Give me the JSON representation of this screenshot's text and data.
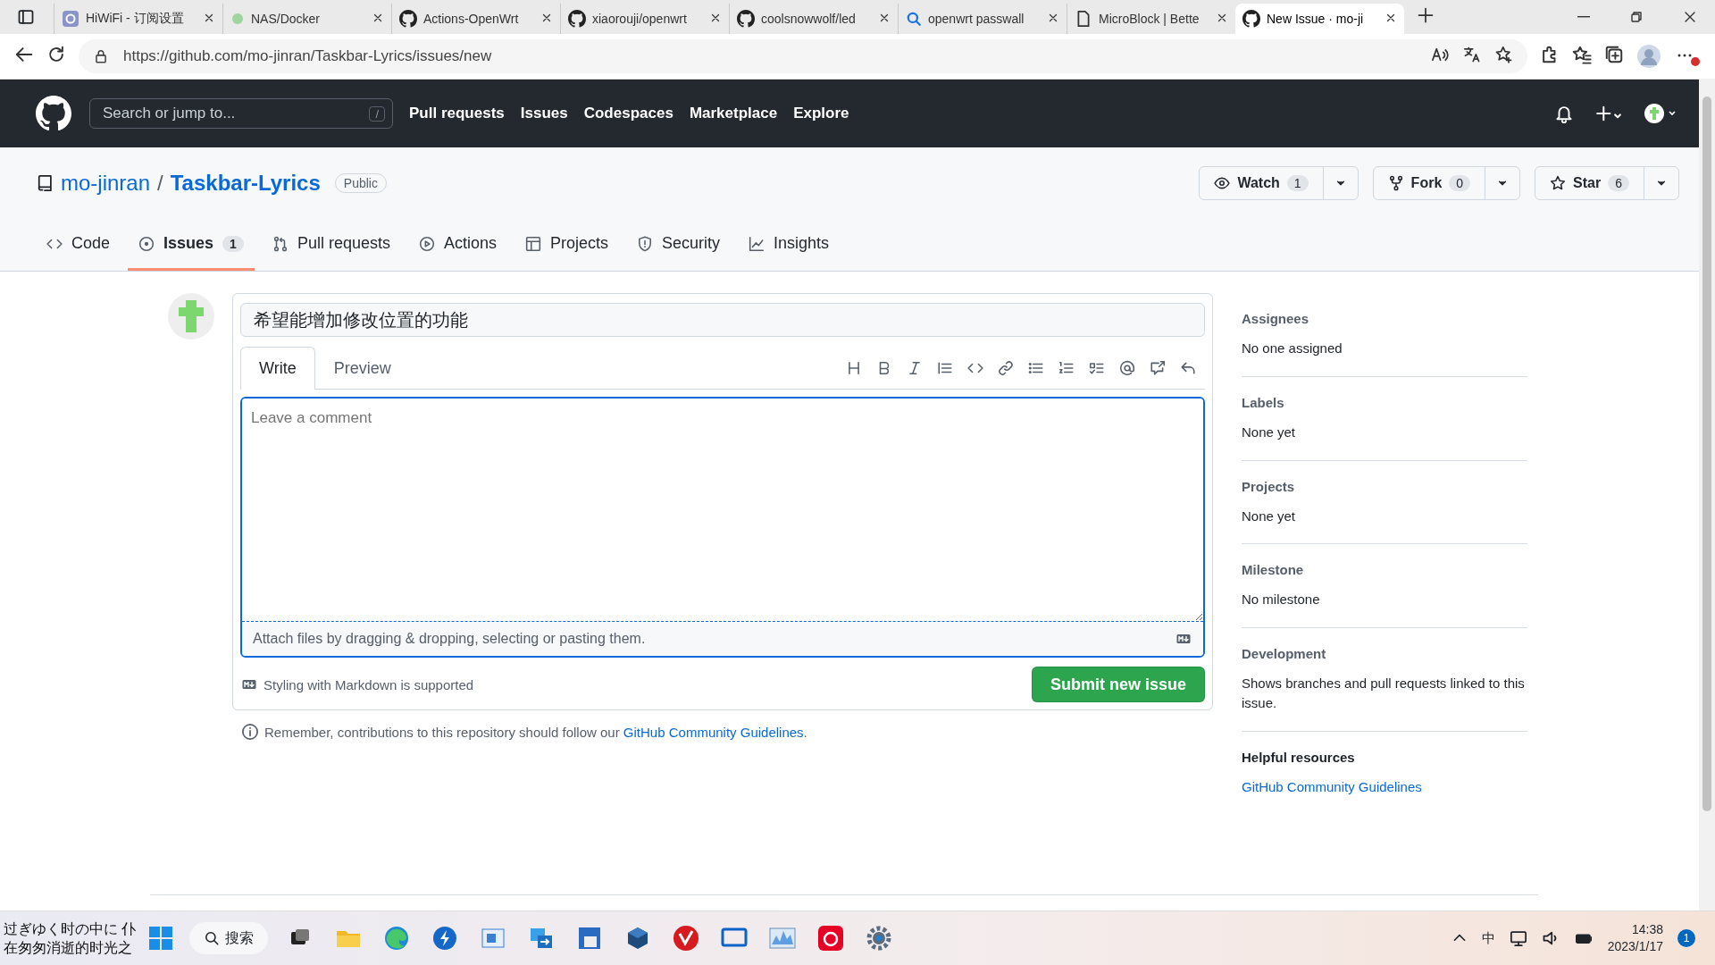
{
  "browser": {
    "tabs": [
      {
        "title": "HiWiFi - 订阅设置",
        "kind": "square",
        "selected": false
      },
      {
        "title": "NAS/Docker",
        "kind": "dot",
        "selected": false
      },
      {
        "title": "Actions-OpenWrt",
        "kind": "github",
        "selected": false
      },
      {
        "title": "xiaorouji/openwrt",
        "kind": "github",
        "selected": false
      },
      {
        "title": "coolsnowwolf/led",
        "kind": "github",
        "selected": false
      },
      {
        "title": "openwrt passwall",
        "kind": "search",
        "selected": false
      },
      {
        "title": "MicroBlock | Bette",
        "kind": "page",
        "selected": false
      },
      {
        "title": "New Issue · mo-ji",
        "kind": "github",
        "selected": true
      }
    ],
    "url": "https://github.com/mo-jinran/Taskbar-Lyrics/issues/new"
  },
  "header": {
    "search_placeholder": "Search or jump to...",
    "shortcut": "/",
    "nav": [
      "Pull requests",
      "Issues",
      "Codespaces",
      "Marketplace",
      "Explore"
    ]
  },
  "repo": {
    "owner": "mo-jinran",
    "separator": "/",
    "name": "Taskbar-Lyrics",
    "visibility": "Public",
    "actions": [
      {
        "kind": "watch",
        "label": "Watch",
        "count": "1"
      },
      {
        "kind": "fork",
        "label": "Fork",
        "count": "0"
      },
      {
        "kind": "star",
        "label": "Star",
        "count": "6"
      }
    ],
    "tabs": [
      {
        "kind": "code",
        "label": "Code",
        "selected": false
      },
      {
        "kind": "issues",
        "label": "Issues",
        "count": "1",
        "selected": true
      },
      {
        "kind": "pulls",
        "label": "Pull requests",
        "selected": false
      },
      {
        "kind": "actions",
        "label": "Actions",
        "selected": false
      },
      {
        "kind": "projects",
        "label": "Projects",
        "selected": false
      },
      {
        "kind": "security",
        "label": "Security",
        "selected": false
      },
      {
        "kind": "insights",
        "label": "Insights",
        "selected": false
      }
    ]
  },
  "form": {
    "title_value": "希望能增加修改位置的功能",
    "editor_tabs": [
      {
        "label": "Write",
        "selected": true
      },
      {
        "label": "Preview",
        "selected": false
      }
    ],
    "comment_placeholder": "Leave a comment",
    "attach_hint": "Attach files by dragging & dropping, selecting or pasting them.",
    "markdown_note": "Styling with Markdown is supported",
    "submit": "Submit new issue",
    "reminder": "Remember, contributions to this repository should follow our ",
    "reminder_link": "GitHub Community Guidelines",
    "reminder_end": "."
  },
  "sidebar": {
    "sections": [
      {
        "heading": "Assignees",
        "text": "No one assigned"
      },
      {
        "heading": "Labels",
        "text": "None yet"
      },
      {
        "heading": "Projects",
        "text": "None yet"
      },
      {
        "heading": "Milestone",
        "text": "No milestone"
      },
      {
        "heading": "Development",
        "text": "Shows branches and pull requests linked to this issue."
      }
    ],
    "resources_heading": "Helpful resources",
    "resources_link": "GitHub Community Guidelines"
  },
  "taskbar": {
    "lyrics": [
      "过ぎゆく时の中に 仆",
      "在匆匆消逝的时光之"
    ],
    "search": "搜索",
    "ime": "中",
    "time": "14:38",
    "date": "2023/1/17",
    "notifications": "1"
  }
}
